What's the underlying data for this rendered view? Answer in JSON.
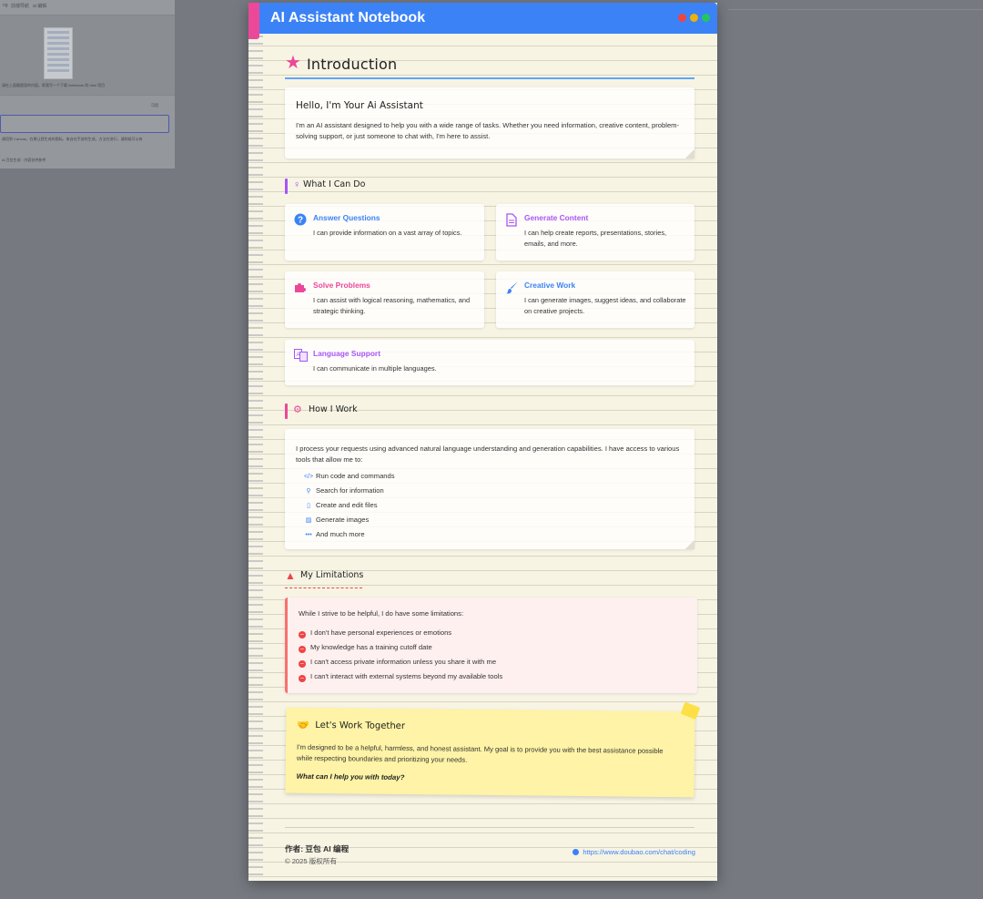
{
  "background_app": {
    "tabs": [
      "ng",
      "前端导航",
      "ai 编辑"
    ],
    "line1": "请在上面截图里的内容。帮我写一个下载 Notebook 的 html 项目",
    "placeholder_text": "可用",
    "line2": "调用到 Canvas，在果让我生成的图标，来自在手部的生成，方法在进行，请稍候可以有",
    "line3": "Ai 豆包生成 · 内容仅供参考"
  },
  "header": {
    "title": "AI Assistant Notebook"
  },
  "intro": {
    "section_title": "Introduction",
    "heading": "Hello, I'm Your Ai Assistant",
    "body": "I'm an AI assistant designed to help you with a wide range of tasks. Whether you need information, creative content, problem-solving support, or just someone to chat with, I'm here to assist."
  },
  "capabilities": {
    "title": "What I Can Do",
    "items": [
      {
        "title": "Answer Questions",
        "desc": "I can provide information on a vast array of topics.",
        "icon": "question-circle-icon"
      },
      {
        "title": "Generate Content",
        "desc": "I can help create reports, presentations, stories, emails, and more.",
        "icon": "document-icon"
      },
      {
        "title": "Solve Problems",
        "desc": "I can assist with logical reasoning, mathematics, and strategic thinking.",
        "icon": "puzzle-icon"
      },
      {
        "title": "Creative Work",
        "desc": "I can generate images, suggest ideas, and collaborate on creative projects.",
        "icon": "paintbrush-icon"
      },
      {
        "title": "Language Support",
        "desc": "I can communicate in multiple languages.",
        "icon": "translate-icon"
      }
    ]
  },
  "how": {
    "title": "How I Work",
    "body": "I process your requests using advanced natural language understanding and generation capabilities. I have access to various tools that allow me to:",
    "tools": [
      {
        "label": "Run code and commands",
        "icon": "code-icon"
      },
      {
        "label": "Search for information",
        "icon": "search-icon"
      },
      {
        "label": "Create and edit files",
        "icon": "file-icon"
      },
      {
        "label": "Generate images",
        "icon": "image-icon"
      },
      {
        "label": "And much more",
        "icon": "ellipsis-icon"
      }
    ]
  },
  "limits": {
    "title": "My Limitations",
    "intro": "While I strive to be helpful, I do have some limitations:",
    "items": [
      "I don't have personal experiences or emotions",
      "My knowledge has a training cutoff date",
      "I can't access private information unless you share it with me",
      "I can't interact with external systems beyond my available tools"
    ]
  },
  "together": {
    "title": "Let's Work Together",
    "body": "I'm designed to be a helpful, harmless, and honest assistant. My goal is to provide you with the best assistance possible while respecting boundaries and prioritizing your needs.",
    "question": "What can I help you with today?"
  },
  "footer": {
    "author": "作者: 豆包 AI 编程",
    "copyright": "© 2025 版权所有",
    "url": "https://www.doubao.com/chat/coding"
  },
  "colors": {
    "header_blue": "#3b82f6",
    "accent_pink": "#ec4899",
    "accent_purple": "#a855f7",
    "warning_red": "#ef4444",
    "sticky_yellow": "#fef3a6"
  }
}
